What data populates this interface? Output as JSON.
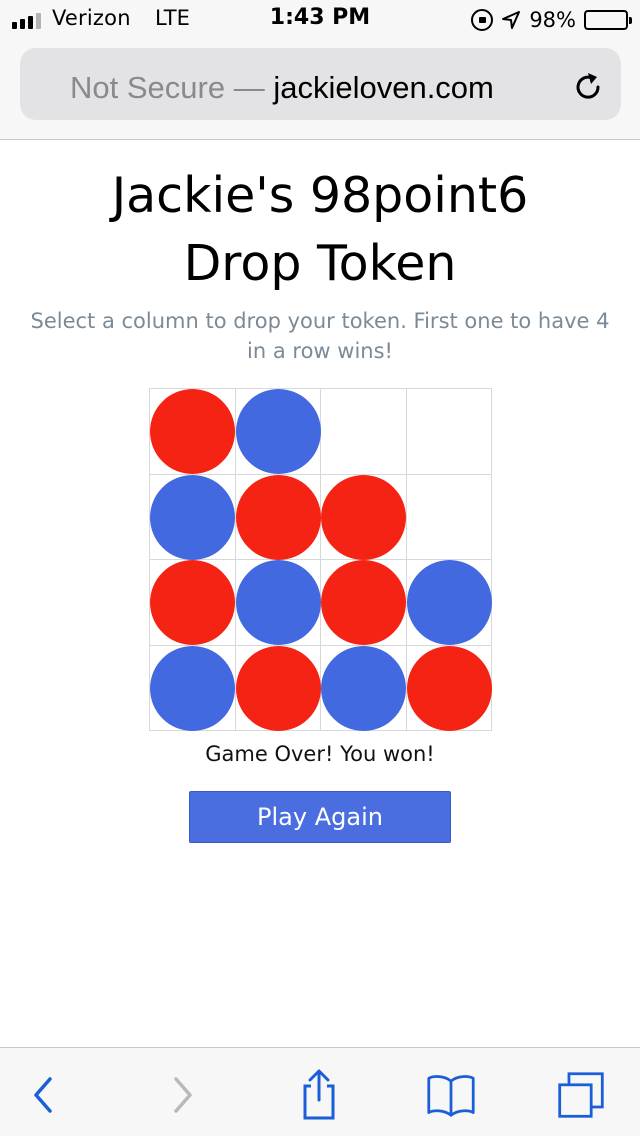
{
  "status_bar": {
    "carrier": "Verizon",
    "network": "LTE",
    "time": "1:43 PM",
    "battery_percent": "98%",
    "battery_level": 0.98,
    "signal_bars_filled": 3,
    "signal_bars_total": 4,
    "icons": [
      "signal-icon",
      "orientation-lock-icon",
      "location-arrow-icon",
      "battery-icon"
    ]
  },
  "browser": {
    "security_label": "Not Secure —",
    "domain": "jackieloven.com",
    "reload_icon": "reload-icon",
    "toolbar_icons": [
      "back-icon",
      "forward-icon",
      "share-icon",
      "bookmarks-icon",
      "tabs-icon"
    ]
  },
  "page": {
    "title_line1": "Jackie's 98point6",
    "title_line2": "Drop Token",
    "subtitle_line1": "Select a column to drop your token. First one to have 4",
    "subtitle_line2": "in a row wins!",
    "result": "Game Over! You won!",
    "play_again_label": "Play Again"
  },
  "board": {
    "rows": 4,
    "columns": 4,
    "colors": {
      "red": "#f52314",
      "blue": "#4369e0"
    },
    "cells": [
      [
        "red",
        "blue",
        "",
        ""
      ],
      [
        "blue",
        "red",
        "red",
        ""
      ],
      [
        "red",
        "blue",
        "red",
        "blue"
      ],
      [
        "blue",
        "red",
        "blue",
        "red"
      ]
    ]
  },
  "colors": {
    "accent": "#4a6ddf",
    "subtitle": "#7b8a96",
    "ios_link_blue": "#1a5fd8"
  }
}
